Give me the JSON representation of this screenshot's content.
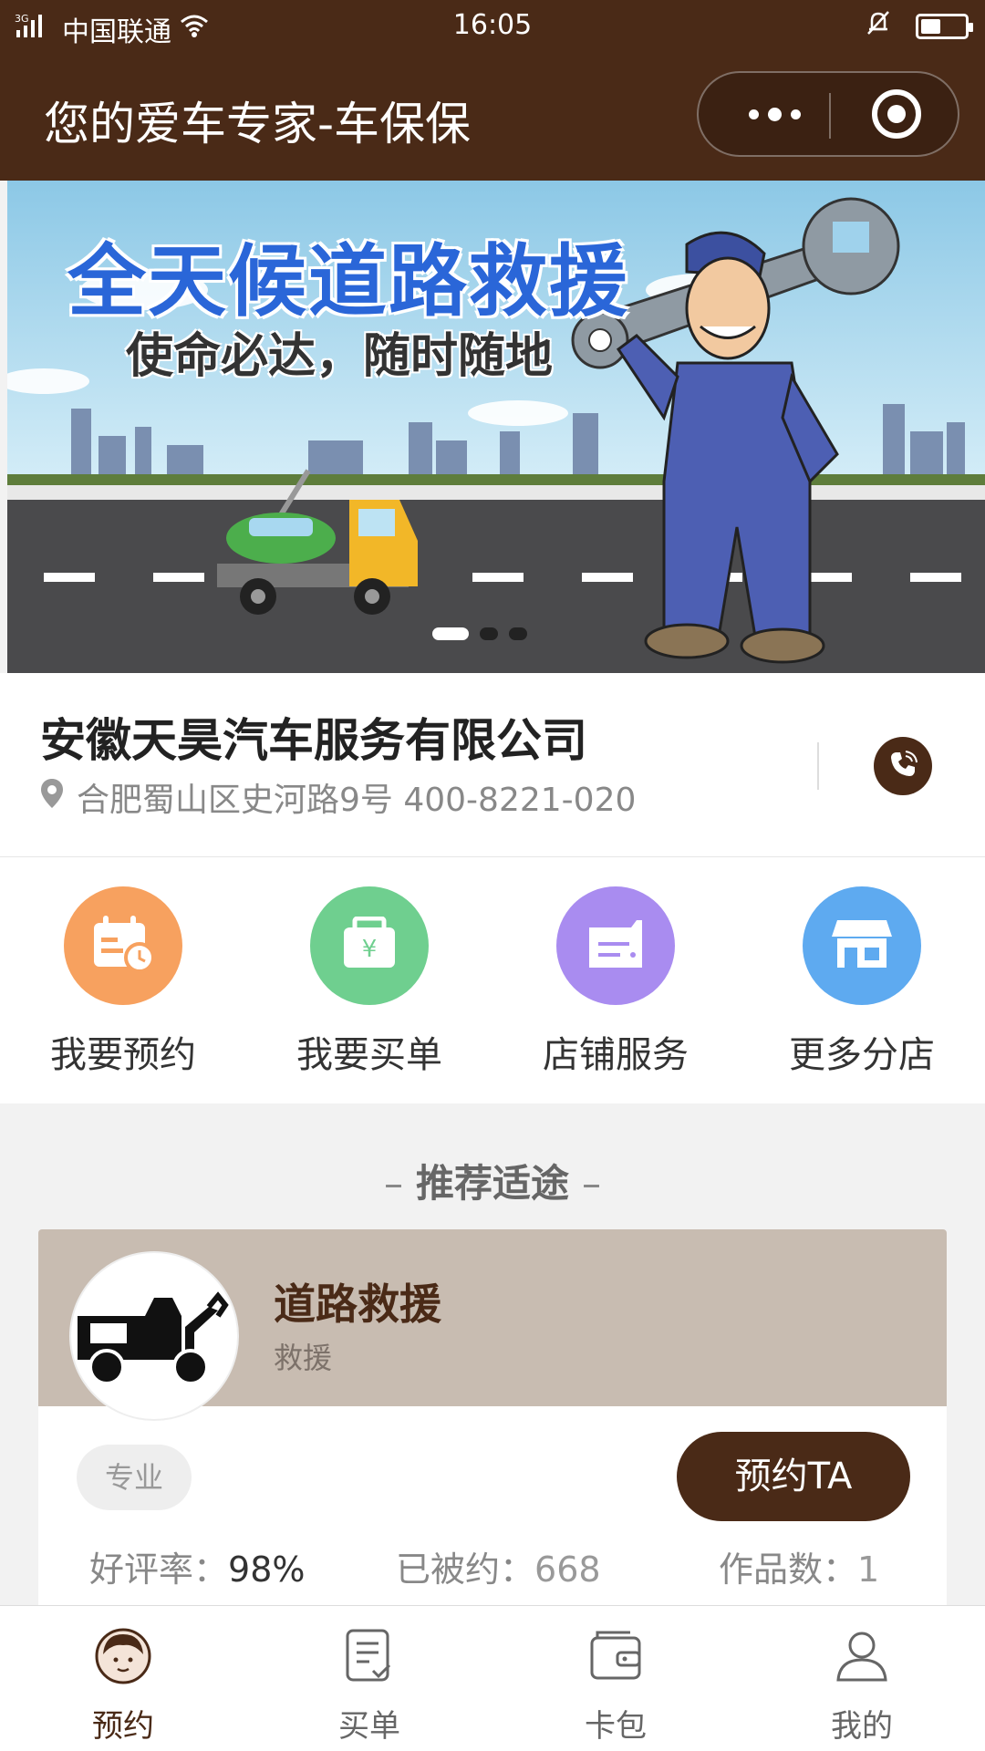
{
  "status_bar": {
    "network": "3G",
    "carrier": "中国联通",
    "time": "16:05",
    "battery_level": 0.45
  },
  "nav": {
    "title": "您的爱车专家-车保保"
  },
  "banner": {
    "headline": "全天候道路救援",
    "subline": "使命必达，随时随地",
    "slide_count": 3,
    "active_slide": 1
  },
  "store": {
    "name": "安徽天昊汽车服务有限公司",
    "address": "合肥蜀山区史河路9号 400-8221-020"
  },
  "menu": [
    {
      "label": "我要预约",
      "icon": "calendar-clock-icon",
      "color": "#f7a15f"
    },
    {
      "label": "我要买单",
      "icon": "wallet-yuan-icon",
      "color": "#6fcf8f"
    },
    {
      "label": "店铺服务",
      "icon": "folder-card-icon",
      "color": "#a98cf0"
    },
    {
      "label": "更多分店",
      "icon": "storefront-icon",
      "color": "#5eaaf0"
    }
  ],
  "recommend": {
    "section_title": "推荐适途",
    "card": {
      "title": "道路救援",
      "subtitle": "救援",
      "tag": "专业",
      "button_label": "预约TA",
      "stats": {
        "rating_label": "好评率：",
        "rating_value": "98%",
        "booked_label": "已被约：",
        "booked_value": "668",
        "works_label": "作品数：",
        "works_value": "1"
      }
    }
  },
  "tabbar": [
    {
      "label": "预约",
      "icon": "avatar-icon",
      "active": true
    },
    {
      "label": "买单",
      "icon": "bill-icon",
      "active": false
    },
    {
      "label": "卡包",
      "icon": "card-wallet-icon",
      "active": false
    },
    {
      "label": "我的",
      "icon": "user-icon",
      "active": false
    }
  ],
  "colors": {
    "brand": "#4a2a17",
    "card_header": "#c8bcb1",
    "page_bg": "#f2f2f2"
  }
}
